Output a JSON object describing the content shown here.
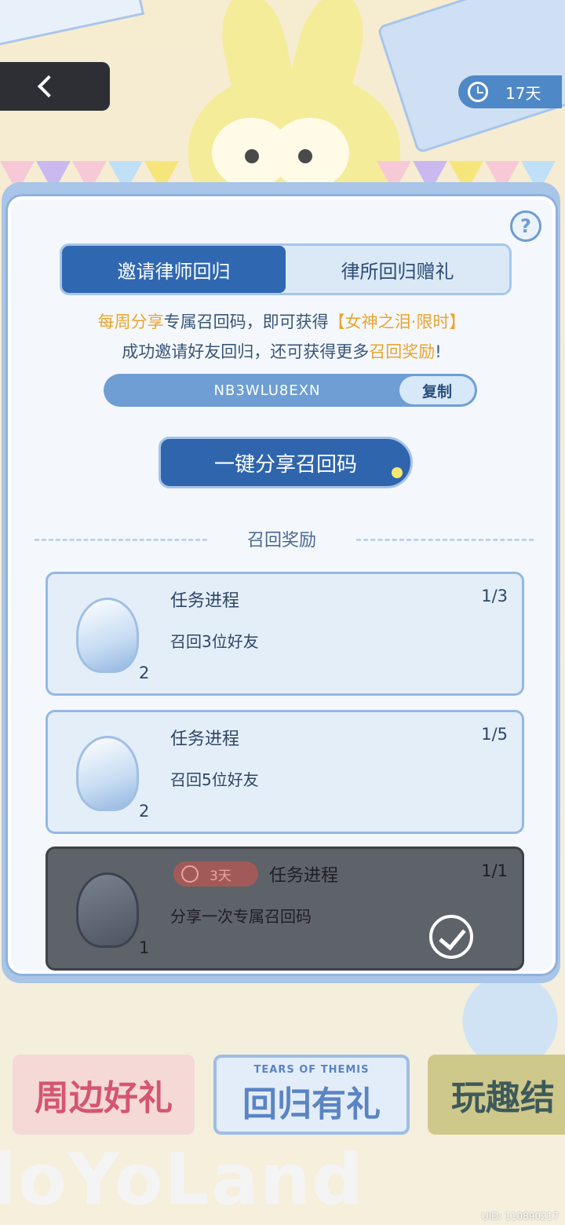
{
  "header": {
    "timer_label": "17天"
  },
  "tabs": [
    {
      "label": "邀请律师回归",
      "active": true
    },
    {
      "label": "律所回归赠礼",
      "active": false
    }
  ],
  "description": {
    "line1_hl1": "每周分享",
    "line1_mid": "专属召回码，即可获得",
    "line1_hl2": "【女神之泪·限时】",
    "line2_pre": "成功邀请好友回归，还可获得更多",
    "line2_hl": "召回奖励",
    "line2_post": "!"
  },
  "code": {
    "value": "NB3WLU8EXN",
    "copy_label": "复制"
  },
  "share_button": "一键分享召回码",
  "section_title": "召回奖励",
  "tasks": [
    {
      "title": "任务进程",
      "progress": "1/3",
      "desc": "召回3位好友",
      "reward_count": "2",
      "done": false
    },
    {
      "title": "任务进程",
      "progress": "1/5",
      "desc": "召回5位好友",
      "reward_count": "2",
      "done": false
    },
    {
      "title": "任务进程",
      "progress": "1/1",
      "desc": "分享一次专属召回码",
      "reward_count": "1",
      "done": true,
      "days": "3天"
    }
  ],
  "banners": {
    "b1": "周边好礼",
    "b2_sub": "TEARS OF THEMIS",
    "b2": "回归有礼",
    "b3": "玩趣结"
  },
  "watermark": "loYoLand",
  "uid": "UID: 110890217",
  "colors": {
    "accent_blue": "#2f65ad",
    "highlight_orange": "#e9a531"
  }
}
